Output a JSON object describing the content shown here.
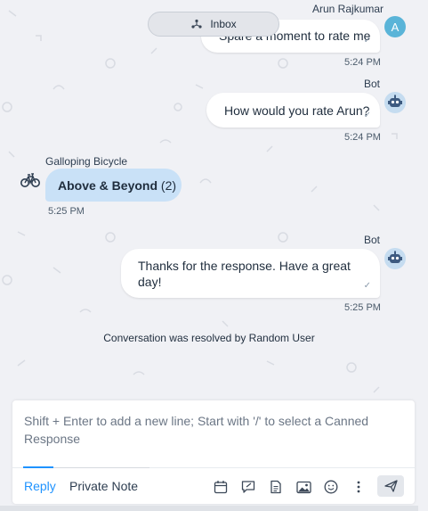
{
  "inbox_pill": {
    "label": "Inbox"
  },
  "messages": [
    {
      "sender": "Arun Rajkumar",
      "text": "Spare a moment to rate me",
      "time": "5:24 PM",
      "avatar_letter": "A"
    },
    {
      "sender": "Bot",
      "text": "How would you rate Arun?",
      "time": "5:24 PM"
    },
    {
      "sender": "Galloping Bicycle",
      "text": "Above & Beyond",
      "rating": "(2)",
      "time": "5:25 PM"
    },
    {
      "sender": "Bot",
      "text": "Thanks for the response. Have a great day!",
      "time": "5:25 PM"
    }
  ],
  "activity": {
    "text": "Conversation was resolved by Random User"
  },
  "composer": {
    "placeholder": "Shift + Enter to add a new line; Start with '/' to select a Canned Response",
    "tabs": {
      "reply": "Reply",
      "private_note": "Private Note"
    }
  },
  "icons": {
    "inbox": "inbox-icon",
    "read_tick": "check-icon",
    "bot_avatar": "robot-icon",
    "contact_avatar": "bicycle-icon",
    "toolbar": [
      "calendar-icon",
      "canned-response-icon",
      "file-icon",
      "image-icon",
      "emoji-icon",
      "more-vertical-icon",
      "send-icon"
    ]
  },
  "colors": {
    "accent": "#1f93ff",
    "avatar_letter_bg": "#5ab4d8",
    "incoming_bubble": "#c9e1f7",
    "background": "#f0f1f5"
  }
}
